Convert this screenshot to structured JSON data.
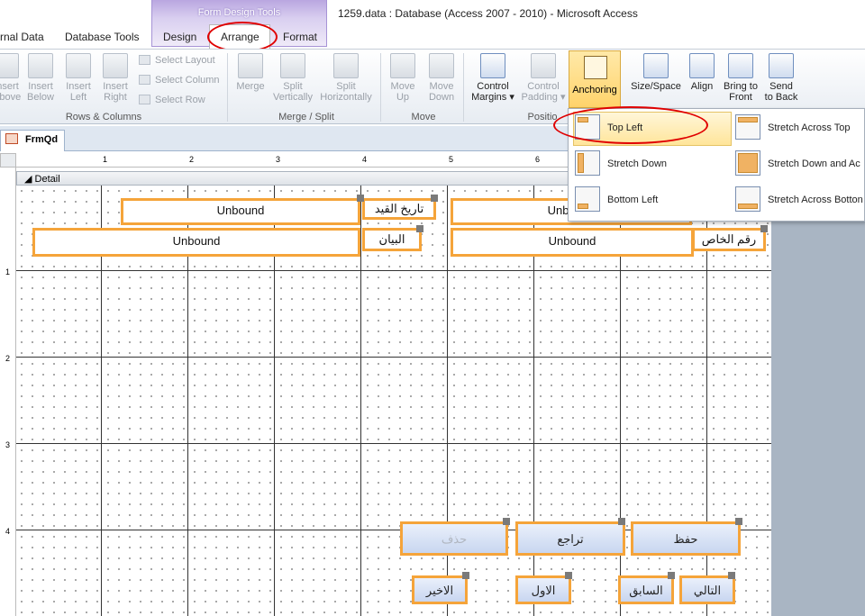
{
  "window": {
    "title": "1259.data : Database (Access 2007 - 2010)  -  Microsoft Access",
    "context_group": "Form Design Tools"
  },
  "tabs": {
    "external_data": "rnal Data",
    "database_tools": "Database Tools",
    "design": "Design",
    "arrange": "Arrange",
    "format": "Format"
  },
  "ribbon": {
    "insert_above": "Insert\nAbove",
    "insert_below": "Insert\nBelow",
    "insert_left": "Insert\nLeft",
    "insert_right": "Insert\nRight",
    "select_layout": "Select Layout",
    "select_column": "Select Column",
    "select_row": "Select Row",
    "group_rows_columns": "Rows & Columns",
    "merge": "Merge",
    "split_vertically": "Split\nVertically",
    "split_horizontally": "Split\nHorizontally",
    "group_merge_split": "Merge / Split",
    "move_up": "Move\nUp",
    "move_down": "Move\nDown",
    "group_move": "Move",
    "control_margins": "Control\nMargins ▾",
    "control_padding": "Control\nPadding ▾",
    "anchoring": "Anchoring",
    "group_position": "Positio",
    "size_space": "Size/Space",
    "align": "Align",
    "bring_to_front": "Bring to\nFront",
    "send_to_back": "Send\nto Back"
  },
  "anchoring_menu": {
    "top_left": "Top Left",
    "stretch_across_top": "Stretch Across Top",
    "stretch_down": "Stretch Down",
    "stretch_down_across": "Stretch Down and Ac",
    "bottom_left": "Bottom Left",
    "stretch_across_bottom": "Stretch Across Botton"
  },
  "document": {
    "tab": "FrmQd",
    "section": "Detail"
  },
  "ruler": {
    "marks": [
      "1",
      "2",
      "3",
      "4",
      "5",
      "6"
    ],
    "vmarks": [
      "1",
      "2",
      "3",
      "4"
    ]
  },
  "form": {
    "unbound": "Unbound",
    "date_label": "تاريخ القيد",
    "desc_label": "البيان",
    "number_label": "رقم الخاص",
    "btn_delete": "حذف",
    "btn_undo": "تراجع",
    "btn_save": "حفظ",
    "btn_last": "الاخير",
    "btn_first": "الاول",
    "btn_prev": "السابق",
    "btn_next": "التالي"
  },
  "colors": {
    "selection": "#f5a43a",
    "highlight_oval": "#e00000",
    "context_tab": "#b9a6e0"
  }
}
